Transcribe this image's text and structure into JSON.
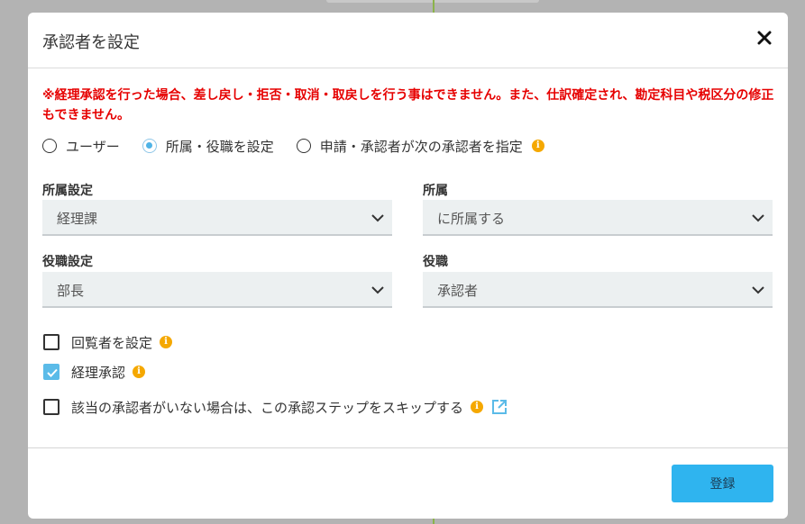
{
  "modal": {
    "title": "承認者を設定",
    "warning": "※経理承認を行った場合、差し戻し・拒否・取消・取戻しを行う事はできません。また、仕訳確定され、勘定科目や税区分の修正もできません。"
  },
  "approver_type": {
    "options": [
      {
        "label": "ユーザー",
        "checked": false
      },
      {
        "label": "所属・役職を設定",
        "checked": true
      },
      {
        "label": "申請・承認者が次の承認者を指定",
        "checked": false
      }
    ]
  },
  "fields": {
    "department_setting": {
      "label": "所属設定",
      "value": "経理課"
    },
    "department": {
      "label": "所属",
      "value": "に所属する"
    },
    "position_setting": {
      "label": "役職設定",
      "value": "部長"
    },
    "position": {
      "label": "役職",
      "value": "承認者"
    }
  },
  "checkboxes": [
    {
      "label": "回覧者を設定",
      "checked": false
    },
    {
      "label": "経理承認",
      "checked": true
    },
    {
      "label": "該当の承認者がいない場合は、この承認ステップをスキップする",
      "checked": false
    }
  ],
  "icons": {
    "info": "i"
  },
  "footer": {
    "submit_label": "登録"
  },
  "colors": {
    "warning": "#e60000",
    "accent": "#2fb4ef",
    "info": "#f5a800"
  }
}
